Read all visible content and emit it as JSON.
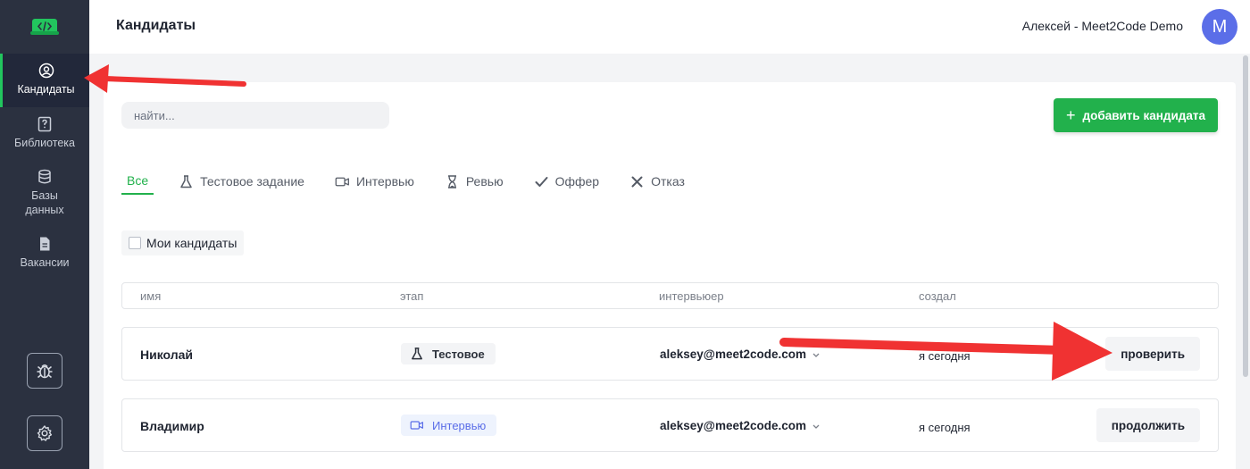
{
  "sidebar": {
    "items": [
      {
        "label": "Кандидаты",
        "icon": "user-circle-icon",
        "active": true
      },
      {
        "label": "Библиотека",
        "icon": "question-book-icon"
      },
      {
        "label": "Базы данных",
        "icon": "database-icon"
      },
      {
        "label": "Вакансии",
        "icon": "document-icon"
      }
    ],
    "bottom": [
      "bug-icon",
      "gear-icon"
    ]
  },
  "header": {
    "title": "Кандидаты",
    "user": "Алексей - Meet2Code Demo",
    "avatar_letter": "M"
  },
  "search": {
    "placeholder": "найти..."
  },
  "add_button": {
    "label": "добавить кандидата"
  },
  "tabs": [
    {
      "label": "Все",
      "active": true
    },
    {
      "label": "Тестовое задание",
      "icon": "flask-icon"
    },
    {
      "label": "Интервью",
      "icon": "video-camera-icon"
    },
    {
      "label": "Ревью",
      "icon": "hourglass-icon"
    },
    {
      "label": "Оффер",
      "icon": "check-icon"
    },
    {
      "label": "Отказ",
      "icon": "x-icon"
    }
  ],
  "filter": {
    "my_candidates": "Мои кандидаты",
    "checked": false
  },
  "table": {
    "columns": [
      "имя",
      "этап",
      "интервьюер",
      "создал"
    ],
    "rows": [
      {
        "name": "Николай",
        "stage": "Тестовое",
        "stage_icon": "flask-icon",
        "interviewer": "aleksey@meet2code.com",
        "created": "я сегодня",
        "action": "проверить"
      },
      {
        "name": "Владимир",
        "stage": "Интервью",
        "stage_icon": "video-camera-icon",
        "interviewer": "aleksey@meet2code.com",
        "created": "я сегодня",
        "action": "продолжить"
      }
    ]
  },
  "colors": {
    "accent": "#22b14c",
    "sidebar": "#2b3140",
    "avatar": "#5b6ee8",
    "annotation": "#f03232"
  }
}
